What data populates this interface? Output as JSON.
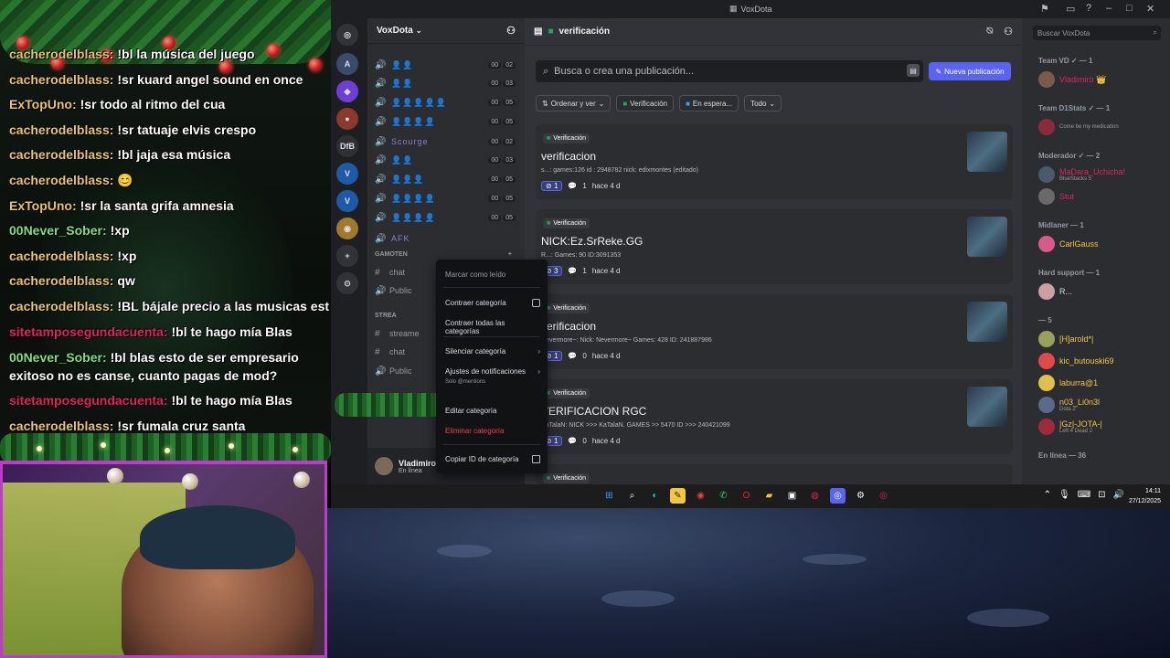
{
  "chat": {
    "lines": [
      {
        "user": "cacherodelblass:",
        "message": "!bl la música del juego",
        "color": "#e9c46a"
      },
      {
        "user": "cacherodelblass:",
        "message": "!sr kuard angel sound en once",
        "color": "#e9c46a"
      },
      {
        "user": "ExTopUno:",
        "message": "!sr todo al ritmo del cua",
        "color": "#e9c46a"
      },
      {
        "user": "cacherodelblass:",
        "message": "!sr tatuaje elvis crespo",
        "color": "#e9c46a"
      },
      {
        "user": "cacherodelblass:",
        "message": "!bl jaja esa música",
        "color": "#e9c46a"
      },
      {
        "user": "cacherodelblass:",
        "message": "😊",
        "color": "#e9c46a"
      },
      {
        "user": "ExTopUno:",
        "message": "!sr la santa grifa amnesia",
        "color": "#e9c46a"
      },
      {
        "user": "00Never_Sober:",
        "message": "!xp",
        "color": "#7ee081"
      },
      {
        "user": "cacherodelblass:",
        "message": "!xp",
        "color": "#e9c46a"
      },
      {
        "user": "cacherodelblass:",
        "message": "qw",
        "color": "#e9c46a"
      },
      {
        "user": "cacherodelblass:",
        "message": "!BL bájale precio a las musicas están puro",
        "color": "#e9c46a"
      },
      {
        "user": "sitetamposegundacuenta:",
        "message": "!bl te hago mía Blas",
        "color": "#e0245e"
      },
      {
        "user": "00Never_Sober:",
        "message": "!bl blas esto de ser empresario exitoso no es canse, cuanto pagas de mod?",
        "color": "#7ee081"
      },
      {
        "user": "sitetamposegundacuenta:",
        "message": "!bl te hago mía Blas",
        "color": "#e0245e"
      },
      {
        "user": "cacherodelblass:",
        "message": "!sr fumala cruz santa",
        "color": "#e9c46a"
      }
    ]
  },
  "discord": {
    "window_title": "VoxDota",
    "servers": [
      "DfB"
    ],
    "guild": {
      "name": "VoxDota"
    },
    "voice_channels": [
      {
        "users": "👤👤",
        "counts": [
          "00",
          "02"
        ]
      },
      {
        "users": "👤👤",
        "counts": [
          "00",
          "03"
        ]
      },
      {
        "users": "👤👤👤👤👤",
        "counts": [
          "00",
          "05"
        ]
      },
      {
        "users": "👤👤👤👤",
        "counts": [
          "00",
          "05"
        ]
      },
      {
        "users": "Scourge",
        "counts": [
          "00",
          "02"
        ]
      },
      {
        "users": "👤👤",
        "counts": [
          "00",
          "03"
        ]
      },
      {
        "users": "👤👤👤",
        "counts": [
          "00",
          "05"
        ]
      },
      {
        "users": "👤👤👤👤",
        "counts": [
          "00",
          "05"
        ]
      },
      {
        "users": "👤👤👤👤",
        "counts": [
          "00",
          "05"
        ]
      },
      {
        "users": "AFK",
        "counts": []
      }
    ],
    "categories": [
      {
        "label": "GAMOTEN"
      },
      {
        "label": "STREA"
      }
    ],
    "text_channels": [
      {
        "name": "chat"
      },
      {
        "name": "Public"
      },
      {
        "name": "streame"
      },
      {
        "name": "chat"
      },
      {
        "name": "Public"
      }
    ],
    "user": {
      "name": "Vladimiro",
      "status": "En línea"
    },
    "forum": {
      "channel": "verificación",
      "search_placeholder": "Busca o crea una publicación...",
      "new_post": "Nueva publicación",
      "sort": "Ordenar y ver",
      "filter_tags": [
        "Verificación",
        "En espera...",
        "Todo"
      ],
      "posts": [
        {
          "tag": "Verificación",
          "title": "verificacion",
          "meta": "s...: games:126 id : 2948782 nick: edixmontes (editado)",
          "reacts": "1",
          "replies": "1",
          "time": "hace 4 d"
        },
        {
          "tag": "Verificación",
          "title": "NICK:Ez.SrReke.GG",
          "meta": "R...: Games: 90 ID:3091353",
          "reacts": "3",
          "replies": "1",
          "time": "hace 4 d"
        },
        {
          "tag": "Verificación",
          "title": "verificacion",
          "meta": "Nevermore~: Nick: Nevermore~ Games: 428 ID: 241887986",
          "reacts": "1",
          "replies": "0",
          "time": "hace 4 d"
        },
        {
          "tag": "Verificación",
          "title": "VERIFICACION RGC",
          "meta": "KaTalaN: NICK >>> KaTalaN. GAMES >> 5470 ID >>> 240421099",
          "reacts": "1",
          "replies": "0",
          "time": "hace 4 d"
        },
        {
          "tag": "Verificación",
          "title": "",
          "meta": "",
          "reacts": "",
          "replies": "",
          "time": ""
        }
      ]
    },
    "members": {
      "search": "Buscar VoxDota",
      "groups": [
        {
          "label": "Team VD ✓ — 1",
          "members": [
            {
              "name": "Vladimiro 👑",
              "sub": "",
              "color": "#e0245e"
            }
          ]
        },
        {
          "label": "Team D1Stats ✓ — 1",
          "members": [
            {
              "name": "",
              "sub": "Come be my medication",
              "color": "#e0245e"
            }
          ]
        },
        {
          "label": "Moderador ✓ — 2",
          "members": [
            {
              "name": "MaDara_Uchicha!",
              "sub": "BlueStacks 5",
              "color": "#e0245e"
            },
            {
              "name": "Stut",
              "sub": "",
              "color": "#e0245e"
            }
          ]
        },
        {
          "label": "Midlaner — 1",
          "members": [
            {
              "name": "CarlGauss",
              "sub": "",
              "color": "#f2c744"
            }
          ]
        },
        {
          "label": "Hard support — 1",
          "members": [
            {
              "name": "R...",
              "sub": "",
              "color": "#dbdee1"
            }
          ]
        },
        {
          "label": "— 5",
          "members": [
            {
              "name": "[H]arold*|",
              "sub": "",
              "color": "#f2c744"
            },
            {
              "name": "kic_butouski69",
              "sub": "",
              "color": "#f2c744"
            },
            {
              "name": "laburra@1",
              "sub": "",
              "color": "#f2c744"
            },
            {
              "name": "n03_Li0n3l",
              "sub": "Dota 2",
              "color": "#f2c744"
            },
            {
              "name": "|Gz|-JOTA-|",
              "sub": "Left 4 Dead 2",
              "color": "#f2c744"
            }
          ]
        },
        {
          "label": "En línea — 36",
          "members": []
        }
      ]
    },
    "context_menu": {
      "mark_read": "Marcar como leído",
      "collapse": "Contraer categoría",
      "collapse_all": "Contraer todas las categorías",
      "mute": "Silenciar categoría",
      "notif": "Ajustes de notificaciones",
      "notif_sub": "Solo @mentions",
      "edit": "Editar categoría",
      "delete": "Eliminar categoría",
      "copy_id": "Copiar ID de categoría"
    }
  },
  "taskbar": {
    "time": "14:11",
    "date": "27/12/2025"
  },
  "colors": {
    "accent": "#5865f2",
    "webcam_border": "#c03ad0",
    "ornament": "#c51f1f"
  }
}
